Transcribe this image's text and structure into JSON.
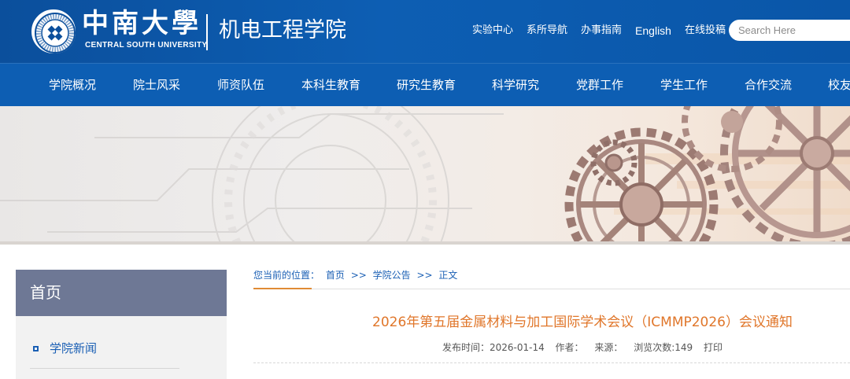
{
  "header": {
    "logo_cn": "中南大學",
    "logo_en": "CENTRAL SOUTH UNIVERSITY",
    "emblem_ring_text": "CENTRAL SOUTH UNIVERSITY",
    "dept_name": "机电工程学院",
    "top_links": [
      "实验中心",
      "系所导航",
      "办事指南",
      "English",
      "在线投稿"
    ],
    "search_placeholder": "Search Here",
    "brand_color": "#0d5eb3"
  },
  "nav": {
    "items": [
      "学院概况",
      "院士风采",
      "师资队伍",
      "本科生教育",
      "研究生教育",
      "科学研究",
      "党群工作",
      "学生工作",
      "合作交流",
      "校友"
    ]
  },
  "banner": {
    "description_icon": "gears-banner"
  },
  "sidebar": {
    "heading": "首页",
    "items": [
      {
        "label": "学院新闻"
      }
    ],
    "accent_color": "#6e7895"
  },
  "breadcrumb": {
    "prefix": "您当前的位置：",
    "items": [
      "首页",
      "学院公告",
      "正文"
    ],
    "separator": ">>"
  },
  "article": {
    "title": "2026年第五届金属材料与加工国际学术会议（ICMMP2026）会议通知",
    "publish_label": "发布时间：",
    "publish_date": "2026-01-14",
    "author_label": "作者：",
    "source_label": "来源：",
    "views_label": "浏览次数:",
    "views": "149",
    "print_label": "打印",
    "title_color": "#e0762a"
  }
}
